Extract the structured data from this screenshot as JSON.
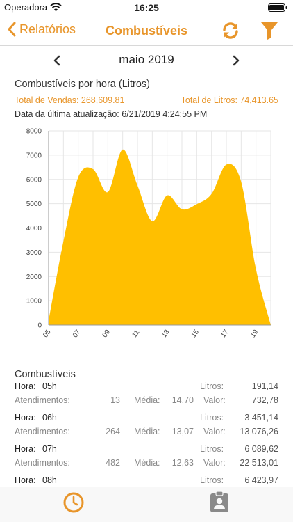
{
  "status_bar": {
    "carrier": "Operadora",
    "time": "16:25"
  },
  "nav": {
    "back_label": "Relatórios",
    "title": "Combustíveis",
    "refresh_icon": "refresh-icon",
    "filter_icon": "filter-icon"
  },
  "month": {
    "label": "maio 2019"
  },
  "summary": {
    "chart_title": "Combustíveis por hora (Litros)",
    "total_sales": "Total de Vendas: 268,609.81",
    "total_liters": "Total de Litros: 74,413.65",
    "last_update": "Data da última atualização: 6/21/2019 4:24:55 PM"
  },
  "colors": {
    "accent": "#e8952a",
    "chart_fill": "#ffbf00",
    "grid": "#e6e6e6"
  },
  "chart_data": {
    "type": "area",
    "x_tick_labels": [
      "05",
      "07",
      "09",
      "11",
      "13",
      "15",
      "17",
      "19"
    ],
    "x": [
      5,
      6,
      7,
      8,
      9,
      10,
      11,
      12,
      13,
      14,
      15,
      16,
      17,
      18,
      19,
      20
    ],
    "values": [
      191,
      3451,
      6090,
      6424,
      5480,
      7230,
      5750,
      4280,
      5340,
      4770,
      4980,
      5400,
      6610,
      5900,
      2300,
      0
    ],
    "y_ticks": [
      0,
      1000,
      2000,
      3000,
      4000,
      5000,
      6000,
      7000,
      8000
    ],
    "ylim": [
      0,
      8000
    ],
    "xlim": [
      5,
      20
    ],
    "grid": true,
    "legend": "none"
  },
  "list": {
    "title": "Combustíveis",
    "labels": {
      "hora": "Hora:",
      "litros": "Litros:",
      "atendimentos": "Atendimentos:",
      "media": "Média:",
      "valor": "Valor:"
    },
    "rows": [
      {
        "hora": "05h",
        "litros": "191,14",
        "atendimentos": "13",
        "media": "14,70",
        "valor": "732,78"
      },
      {
        "hora": "06h",
        "litros": "3 451,14",
        "atendimentos": "264",
        "media": "13,07",
        "valor": "13 076,26"
      },
      {
        "hora": "07h",
        "litros": "6 089,62",
        "atendimentos": "482",
        "media": "12,63",
        "valor": "22 513,01"
      },
      {
        "hora": "08h",
        "litros": "6 423,97",
        "atendimentos": "",
        "media": "",
        "valor": ""
      }
    ]
  },
  "tab_bar": {
    "items": [
      {
        "icon": "clock-icon"
      },
      {
        "icon": "clipboard-user-icon"
      }
    ]
  }
}
